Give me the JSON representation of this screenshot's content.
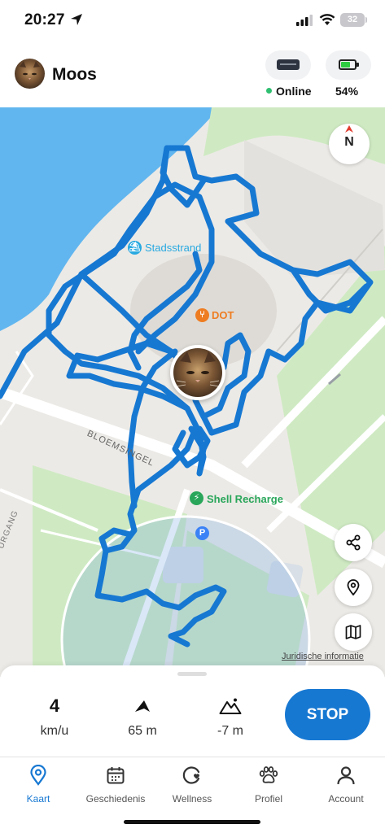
{
  "status_bar": {
    "time": "20:27",
    "battery": "32",
    "icons": [
      "location-arrow-icon",
      "cellular-signal-icon",
      "wifi-icon",
      "battery-icon"
    ]
  },
  "header": {
    "pet_name": "Moos",
    "connection_status": "Online",
    "battery_percent": "54%",
    "online_color": "#2fbf71"
  },
  "map": {
    "compass_label": "N",
    "labels": {
      "beach": "Stadsstrand",
      "restaurant": "DOT",
      "charger": "Shell Recharge",
      "road": "BLOEMSINGEL",
      "road2": "URGANG"
    },
    "parking_label": "P",
    "legal_link": "Juridische informatie",
    "track_color": "#1778d2"
  },
  "stats": {
    "speed_value": "4",
    "speed_unit": "km/u",
    "distance": "65 m",
    "elevation": "-7 m"
  },
  "stop_label": "STOP",
  "tabs": [
    {
      "label": "Kaart",
      "icon": "map-pin-icon",
      "active": true
    },
    {
      "label": "Geschiedenis",
      "icon": "calendar-icon",
      "active": false
    },
    {
      "label": "Wellness",
      "icon": "wellness-icon",
      "active": false
    },
    {
      "label": "Profiel",
      "icon": "paw-icon",
      "active": false
    },
    {
      "label": "Account",
      "icon": "person-icon",
      "active": false
    }
  ],
  "accent_color": "#1778d2"
}
